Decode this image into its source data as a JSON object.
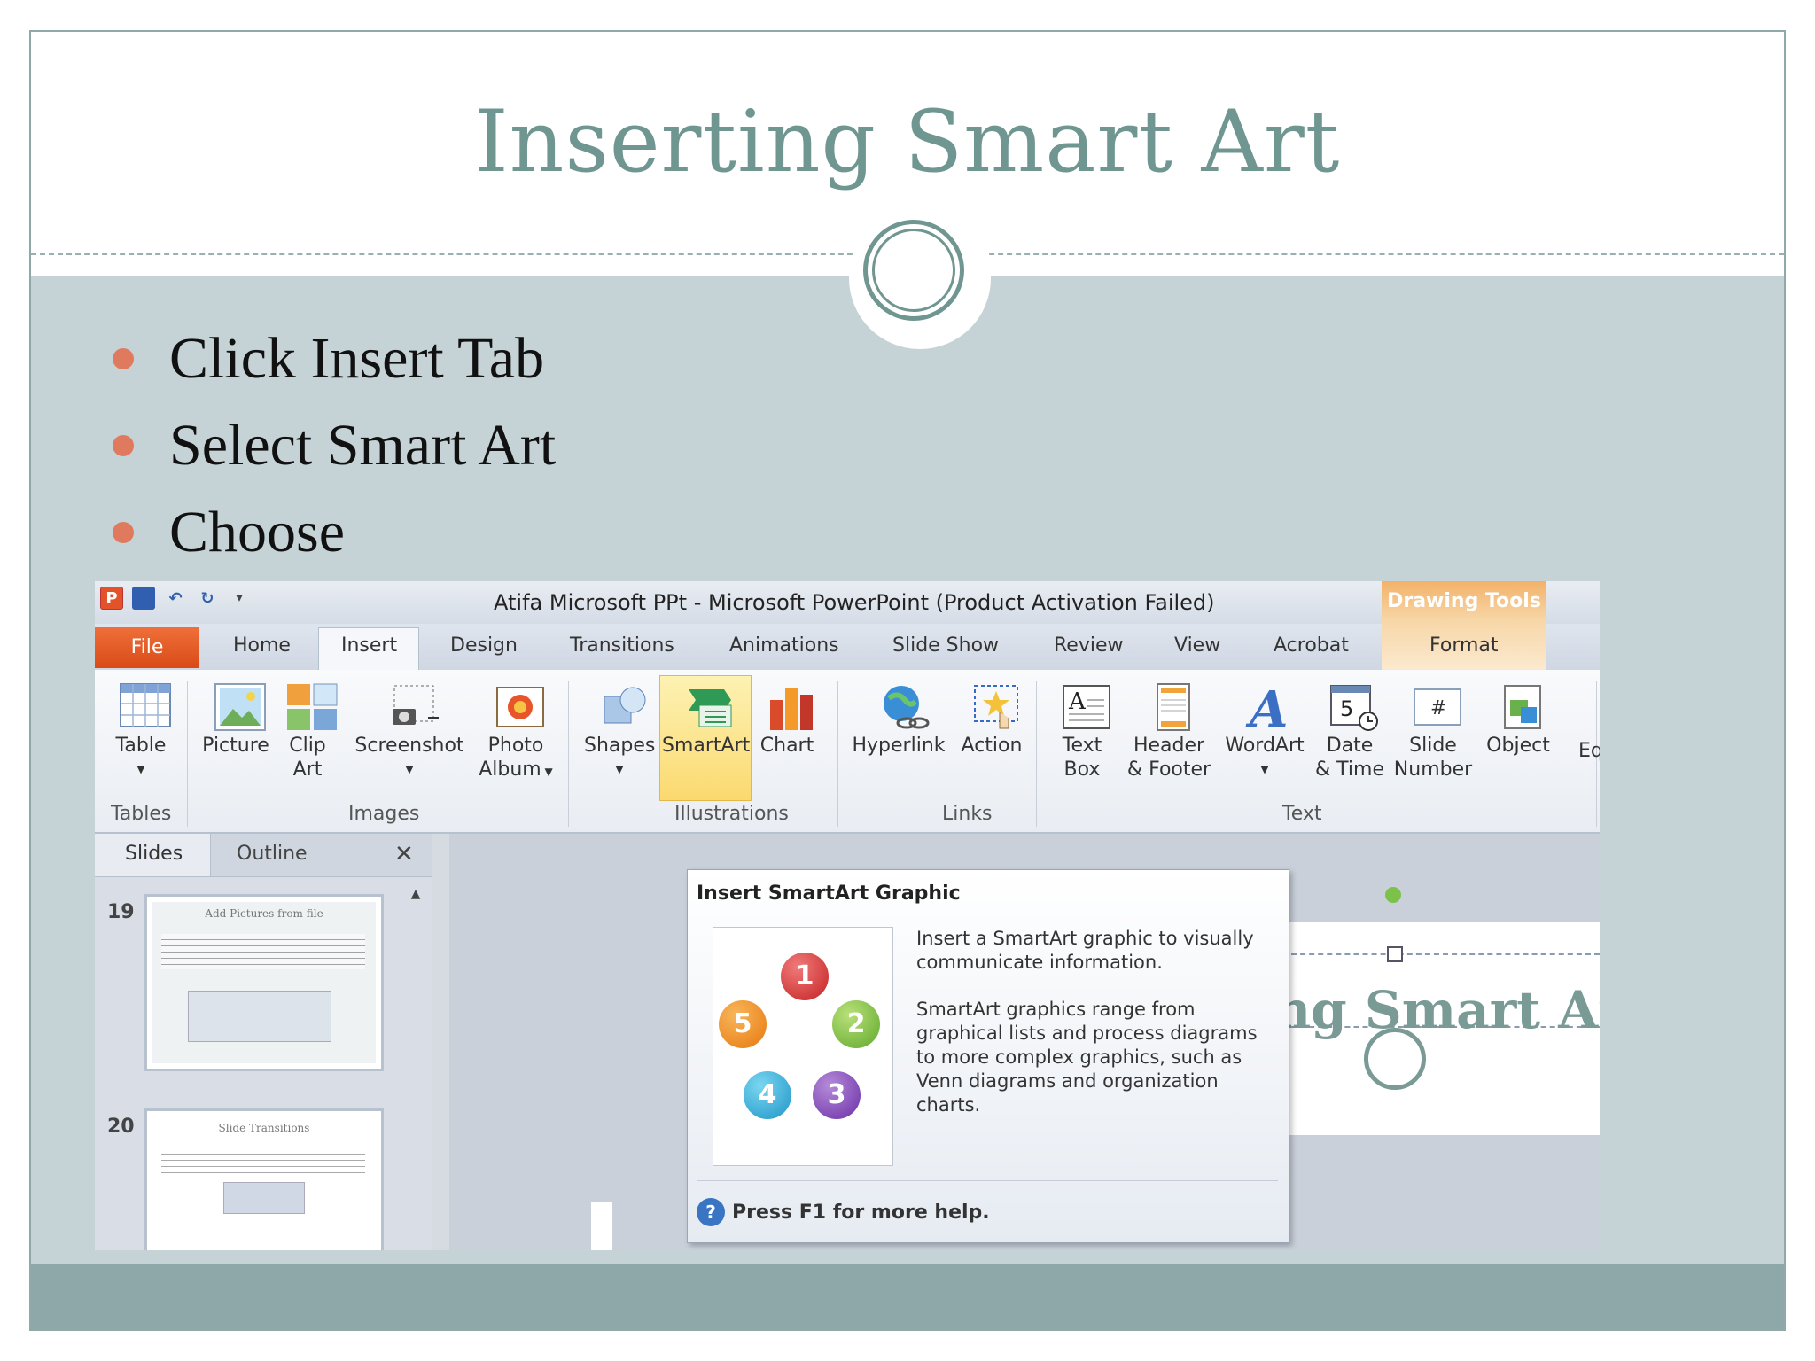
{
  "slide": {
    "title": "Inserting Smart Art",
    "bullets": [
      "Click Insert Tab",
      "Select Smart Art",
      "Choose"
    ]
  },
  "window": {
    "title": "Atifa Microsoft PPt  -  Microsoft PowerPoint (Product Activation Failed)",
    "contextual_group": "Drawing Tools",
    "contextual_tab": "Format"
  },
  "tabs": [
    "File",
    "Home",
    "Insert",
    "Design",
    "Transitions",
    "Animations",
    "Slide Show",
    "Review",
    "View",
    "Acrobat"
  ],
  "active_tab": "Insert",
  "ribbon": {
    "buttons": {
      "table": "Table",
      "picture": "Picture",
      "clip_art_1": "Clip",
      "clip_art_2": "Art",
      "screenshot": "Screenshot",
      "photo_album_1": "Photo",
      "photo_album_2": "Album",
      "shapes": "Shapes",
      "smartart": "SmartArt",
      "chart": "Chart",
      "hyperlink": "Hyperlink",
      "action": "Action",
      "text_box_1": "Text",
      "text_box_2": "Box",
      "header_footer_1": "Header",
      "header_footer_2": "& Footer",
      "wordart": "WordArt",
      "date_time_1": "Date",
      "date_time_2": "& Time",
      "slide_number_1": "Slide",
      "slide_number_2": "Number",
      "object": "Object",
      "equation_partial": "Eq"
    },
    "groups": {
      "tables": "Tables",
      "images": "Images",
      "illustrations": "Illustrations",
      "links": "Links",
      "text": "Text"
    }
  },
  "pane": {
    "tabs": [
      "Slides",
      "Outline"
    ],
    "thumbnails": [
      {
        "number": "19",
        "title": "Add Pictures from file"
      },
      {
        "number": "20",
        "title": "Slide Transitions"
      }
    ]
  },
  "tooltip": {
    "title": "Insert SmartArt Graphic",
    "description_1": "Insert a SmartArt graphic to visually communicate information.",
    "description_2": "SmartArt graphics range from graphical lists and process diagrams to more complex graphics, such as Venn diagrams and organization charts.",
    "help": "Press F1 for more help.",
    "cycle_numbers": [
      "1",
      "2",
      "3",
      "4",
      "5"
    ]
  },
  "slide_preview_text": "ng Smart Art",
  "colors": {
    "accent": "#6f9690",
    "bullet": "#e07a5f",
    "file_tab": "#e55a25",
    "smartart_highlight": "#fbd970"
  }
}
